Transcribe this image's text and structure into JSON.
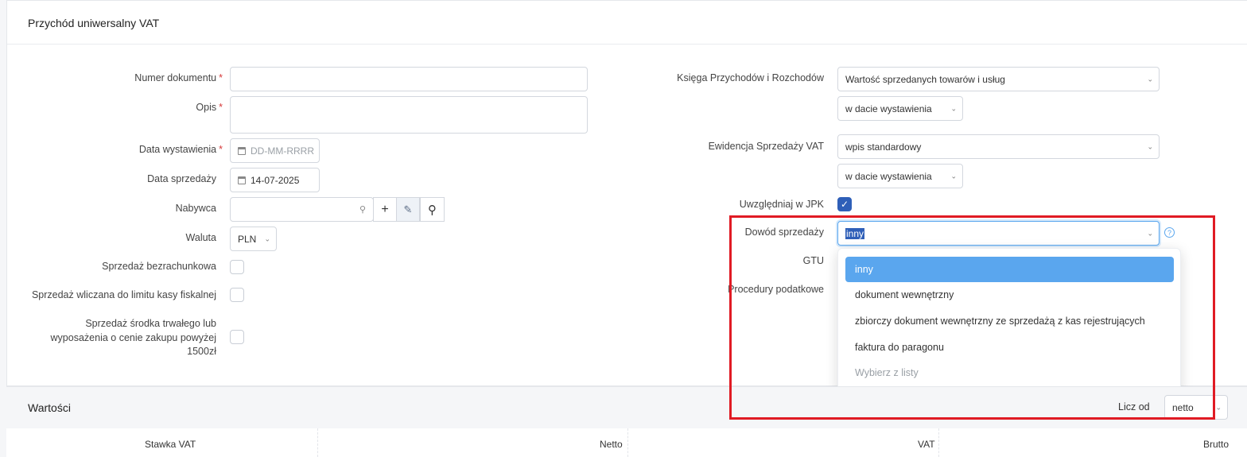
{
  "header": {
    "title": "Przychód uniwersalny VAT"
  },
  "left_form": {
    "document_number": {
      "label": "Numer dokumentu",
      "value": ""
    },
    "description": {
      "label": "Opis",
      "value": ""
    },
    "issue_date": {
      "label": "Data wystawienia",
      "placeholder": "DD-MM-RRRR"
    },
    "sale_date": {
      "label": "Data sprzedaży",
      "value": "14-07-2025"
    },
    "buyer": {
      "label": "Nabywca",
      "value": ""
    },
    "currency": {
      "label": "Waluta",
      "value": "PLN"
    },
    "non_accounting_sale": {
      "label": "Sprzedaż bezrachunkowa"
    },
    "cash_register_limit": {
      "label": "Sprzedaż wliczana do limitu kasy fiskalnej"
    },
    "fixed_asset_sale": {
      "label_line1": "Sprzedaż środka trwałego lub",
      "label_line2": "wyposażenia o cenie zakupu powyżej",
      "label_line3": "1500zł"
    }
  },
  "right_form": {
    "kpir": {
      "label": "Księga Przychodów i Rozchodów",
      "value": "Wartość sprzedanych towarów i usług",
      "date_mode": "w dacie wystawienia"
    },
    "vat_register": {
      "label": "Ewidencja Sprzedaży VAT",
      "value": "wpis standardowy",
      "date_mode": "w dacie wystawienia"
    },
    "include_jpk": {
      "label": "Uwzględniaj w JPK",
      "checked": true
    },
    "sale_proof": {
      "label": "Dowód sprzedaży",
      "value": "inny",
      "options": [
        "inny",
        "dokument wewnętrzny",
        "zbiorczy dokument wewnętrzny ze sprzedażą z kas rejestrujących",
        "faktura do paragonu",
        "Wybierz z listy"
      ]
    },
    "gtu": {
      "label": "GTU"
    },
    "tax_procedures": {
      "label": "Procedury podatkowe"
    }
  },
  "values_section": {
    "title": "Wartości",
    "count_from_label": "Licz od",
    "count_from_value": "netto",
    "columns": [
      "Stawka VAT",
      "Netto",
      "VAT",
      "Brutto"
    ]
  },
  "colors": {
    "accent": "#2f5fb8",
    "highlight_option": "#5aa6ee",
    "annotation_red": "#e01b24"
  }
}
